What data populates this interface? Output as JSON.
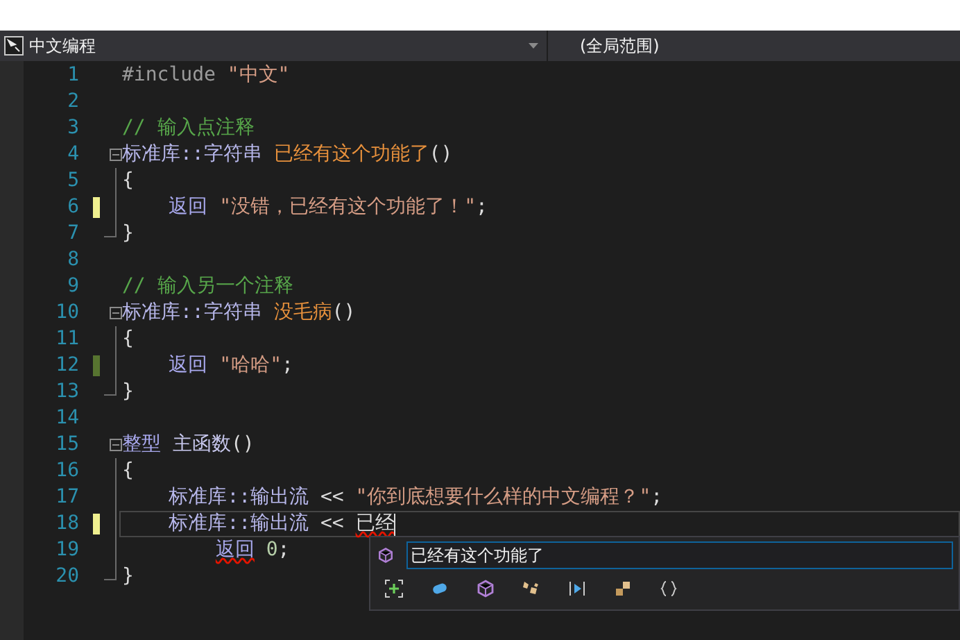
{
  "nav": {
    "file": "中文编程",
    "scope": "(全局范围)"
  },
  "lines": [
    {
      "number": "1",
      "collapsible": false,
      "current": false,
      "cursor": false,
      "tokens": [
        {
          "kind": "preprocessor",
          "text": "#include "
        },
        {
          "kind": "string",
          "text": "\"中文\""
        }
      ]
    },
    {
      "number": "2",
      "collapsible": false,
      "current": false,
      "cursor": false
    },
    {
      "number": "3",
      "collapsible": false,
      "current": false,
      "cursor": false,
      "tokens": [
        {
          "kind": "comment",
          "text": "// 输入点注释"
        }
      ]
    },
    {
      "number": "4",
      "collapsible": true,
      "current": false,
      "cursor": false,
      "tokens": [
        {
          "kind": "type",
          "text": "标准库::字符串 "
        },
        {
          "kind": "function",
          "text": "已经有这个功能了"
        },
        {
          "kind": "plain",
          "text": "()"
        }
      ]
    },
    {
      "number": "5",
      "collapsible": false,
      "in_block": true,
      "block_end": false,
      "current": false,
      "cursor": false,
      "tokens": [
        {
          "kind": "plain",
          "text": "{"
        }
      ]
    },
    {
      "number": "6",
      "collapsible": false,
      "in_block": true,
      "block_end": false,
      "current": false,
      "cursor": false,
      "color": "#efef8f",
      "tokens": [
        {
          "kind": "keyword",
          "text": "    返回 "
        },
        {
          "kind": "string",
          "text": "\"没错，已经有这个功能了！\""
        },
        {
          "kind": "plain",
          "text": ";"
        }
      ]
    },
    {
      "number": "7",
      "collapsible": false,
      "in_block": true,
      "block_end": true,
      "current": false,
      "cursor": false,
      "tokens": [
        {
          "kind": "plain",
          "text": "}"
        }
      ]
    },
    {
      "number": "8",
      "collapsible": false,
      "current": false,
      "cursor": false
    },
    {
      "number": "9",
      "collapsible": false,
      "current": false,
      "cursor": false,
      "tokens": [
        {
          "kind": "comment",
          "text": "// 输入另一个注释"
        }
      ]
    },
    {
      "number": "10",
      "collapsible": true,
      "current": false,
      "cursor": false,
      "tokens": [
        {
          "kind": "type",
          "text": "标准库::字符串 "
        },
        {
          "kind": "function",
          "text": "没毛病"
        },
        {
          "kind": "plain",
          "text": "()"
        }
      ]
    },
    {
      "number": "11",
      "collapsible": false,
      "in_block": true,
      "block_end": false,
      "current": false,
      "cursor": false,
      "tokens": [
        {
          "kind": "plain",
          "text": "{"
        }
      ]
    },
    {
      "number": "12",
      "collapsible": false,
      "in_block": true,
      "block_end": false,
      "current": false,
      "cursor": false,
      "color": "#577430",
      "tokens": [
        {
          "kind": "keyword",
          "text": "    返回 "
        },
        {
          "kind": "string",
          "text": "\"哈哈\""
        },
        {
          "kind": "plain",
          "text": ";"
        }
      ]
    },
    {
      "number": "13",
      "collapsible": false,
      "in_block": true,
      "block_end": true,
      "current": false,
      "cursor": false,
      "tokens": [
        {
          "kind": "plain",
          "text": "}"
        }
      ]
    },
    {
      "number": "14",
      "collapsible": false,
      "current": false,
      "cursor": false
    },
    {
      "number": "15",
      "collapsible": true,
      "current": false,
      "cursor": false,
      "tokens": [
        {
          "kind": "keyword",
          "text": "整型 "
        },
        {
          "kind": "function2",
          "text": "主函数"
        },
        {
          "kind": "plain",
          "text": "()"
        }
      ]
    },
    {
      "number": "16",
      "collapsible": false,
      "in_block": true,
      "block_end": false,
      "current": false,
      "cursor": false,
      "tokens": [
        {
          "kind": "plain",
          "text": "{"
        }
      ]
    },
    {
      "number": "17",
      "collapsible": false,
      "in_block": true,
      "block_end": false,
      "current": false,
      "cursor": false,
      "tokens": [
        {
          "kind": "type",
          "text": "    标准库::输出流"
        },
        {
          "kind": "plain",
          "text": " << "
        },
        {
          "kind": "string",
          "text": "\"你到底想要什么样的中文编程？\""
        },
        {
          "kind": "plain",
          "text": ";"
        }
      ]
    },
    {
      "number": "18",
      "collapsible": false,
      "in_block": true,
      "block_end": false,
      "current": true,
      "cursor": true,
      "color": "#efef8f",
      "tokens": [
        {
          "kind": "type",
          "text": "    标准库::输出流"
        },
        {
          "kind": "plain",
          "text": " << "
        },
        {
          "kind": "plain",
          "text": "已经",
          "error": true
        }
      ]
    },
    {
      "number": "19",
      "collapsible": false,
      "in_block": true,
      "block_end": false,
      "current": false,
      "cursor": false,
      "tokens": [
        {
          "kind": "keyword",
          "text": "        返回",
          "error": true
        },
        {
          "kind": "number",
          "text": " 0"
        },
        {
          "kind": "plain",
          "text": ";"
        }
      ]
    },
    {
      "number": "20",
      "collapsible": false,
      "in_block": true,
      "block_end": true,
      "current": false,
      "cursor": false,
      "tokens": [
        {
          "kind": "plain",
          "text": "}"
        }
      ]
    }
  ],
  "completion": {
    "items": [
      {
        "text": "已经有这个功能了",
        "selected": true
      }
    ]
  }
}
